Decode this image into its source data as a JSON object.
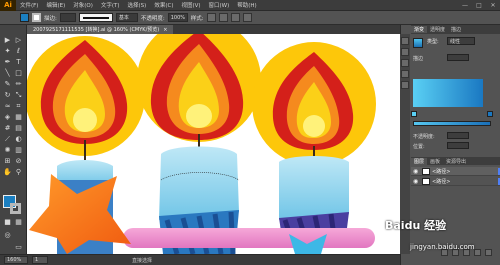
{
  "app": {
    "logo": "Ai"
  },
  "menu": [
    "文件(F)",
    "编辑(E)",
    "对象(O)",
    "文字(T)",
    "选择(S)",
    "效果(C)",
    "视图(V)",
    "窗口(W)",
    "帮助(H)"
  ],
  "control": {
    "style_label": "描边:",
    "opacity_label": "不透明度:",
    "opacity_value": "100%",
    "style2_label": "样式:",
    "preset": "基本"
  },
  "document": {
    "tab_title": "2007925171111535 [转换].ai @ 160% (CMYK/预览)",
    "close": "×"
  },
  "status": {
    "zoom": "160%",
    "page": "1",
    "status_text": "直接选择"
  },
  "panel": {
    "tabs": [
      "渐变",
      "透明度",
      "描边"
    ],
    "type_label": "类型:",
    "type_value": "线性",
    "fields": [
      {
        "label": "描边",
        "value": ""
      },
      {
        "label": "不透明度:",
        "value": ""
      },
      {
        "label": "位置:",
        "value": ""
      }
    ],
    "stop_colors": [
      "#5ad0f4",
      "#1a78c2"
    ]
  },
  "layers": {
    "tabs": [
      "图层",
      "画板",
      "资源导出"
    ],
    "rows": [
      {
        "name": "<路径>",
        "color": "#4f7ff5"
      },
      {
        "name": "<路径>",
        "color": "#4f7ff5"
      }
    ]
  },
  "colors": {
    "accent": "#1b7fc1",
    "flame_outer": "#fdc70a",
    "flame_red": "#d4201a",
    "flame_orange": "#f58a1e",
    "candle_blue": "#9fd8ee",
    "wick": "#3a2a1a"
  },
  "watermark": {
    "brand": "Baidu 经验",
    "url": "jingyan.baidu.com"
  }
}
